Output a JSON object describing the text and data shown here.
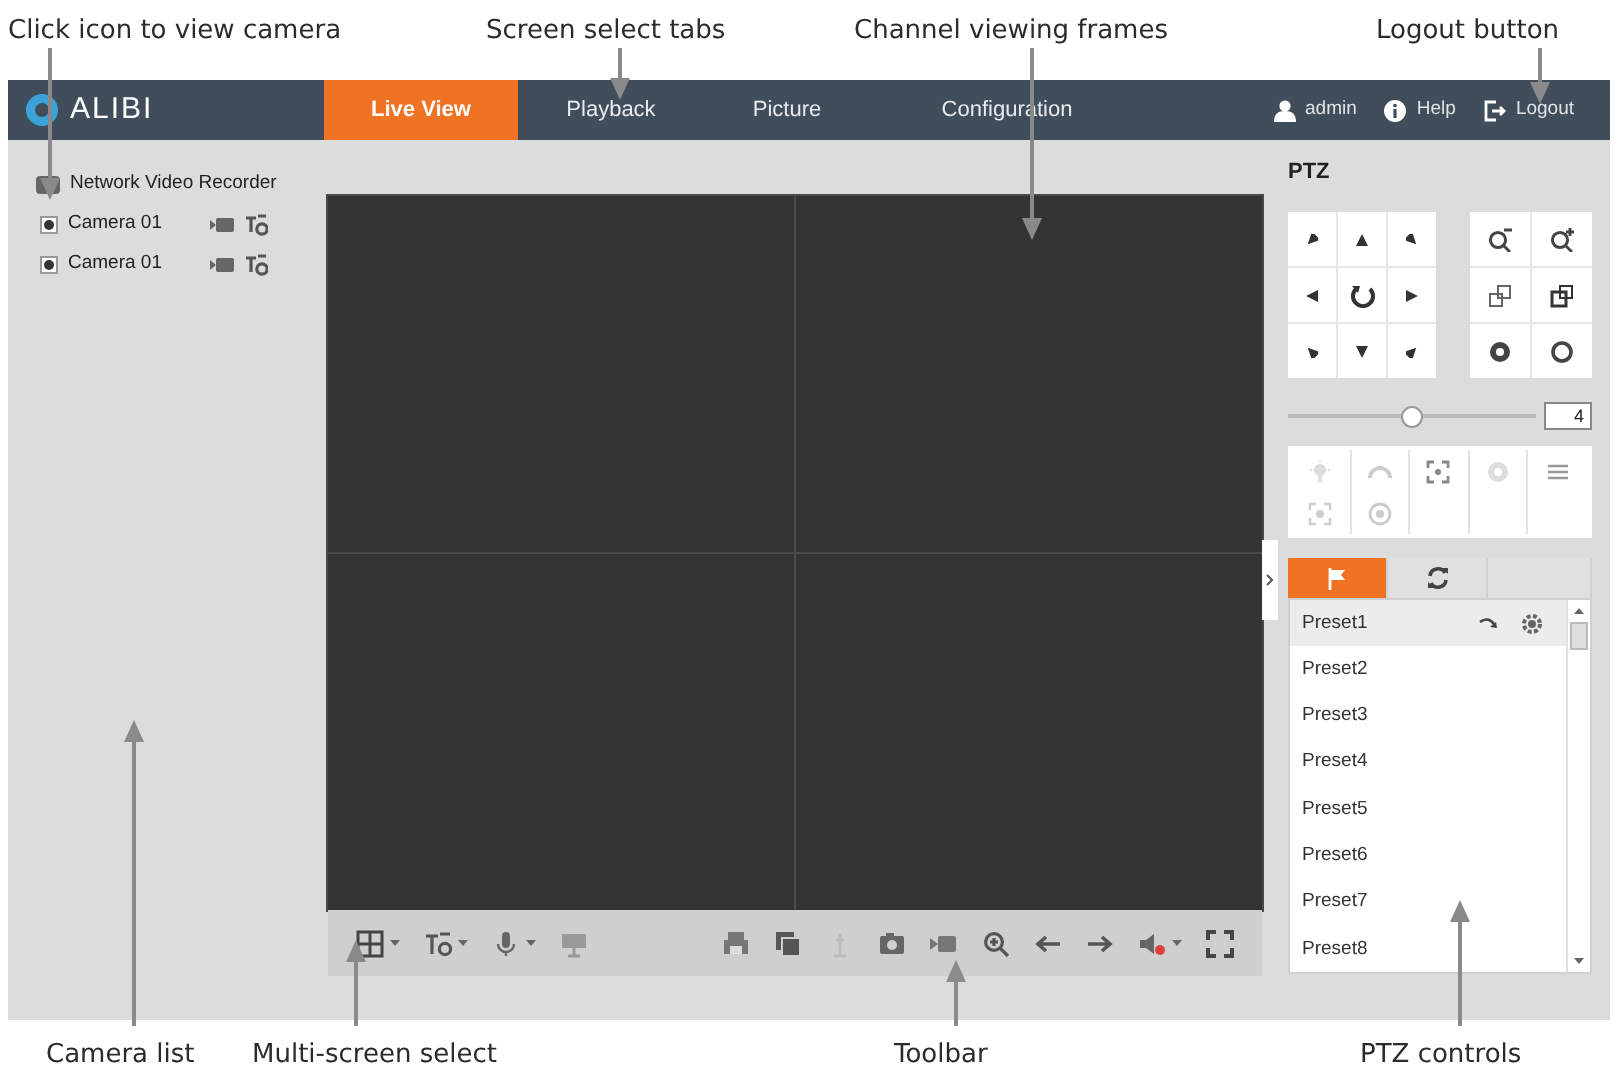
{
  "annotations_top": [
    "Click icon to view camera",
    "Screen select tabs",
    "Channel viewing frames",
    "Logout button"
  ],
  "header": {
    "logo": "ALIBI",
    "tabs": [
      {
        "label": "Live View",
        "selected": true
      },
      {
        "label": "Playback",
        "selected": false
      },
      {
        "label": "Picture",
        "selected": false
      },
      {
        "label": "Configuration",
        "selected": false
      }
    ],
    "user": "admin",
    "help": "Help",
    "logout": "Logout"
  },
  "camera_tree": {
    "root": "Network Video Recorder",
    "cameras": [
      {
        "label": "Camera 01"
      },
      {
        "label": "Camera 01"
      }
    ]
  },
  "ptz": {
    "title": "PTZ",
    "speed": {
      "level": 0.5,
      "reading": "4"
    },
    "tabs": [
      {
        "kind": "preset",
        "selected": true
      },
      {
        "kind": "patrol",
        "selected": false
      }
    ],
    "presets": [
      {
        "label": "Preset1",
        "selected": true
      },
      {
        "label": "Preset2",
        "selected": false
      },
      {
        "label": "Preset3",
        "selected": false
      },
      {
        "label": "Preset4",
        "selected": false
      },
      {
        "label": "Preset5",
        "selected": false
      },
      {
        "label": "Preset6",
        "selected": false
      },
      {
        "label": "Preset7",
        "selected": false
      },
      {
        "label": "Preset8",
        "selected": false
      }
    ]
  },
  "annotations_bottom": [
    "Camera list",
    "Multi-screen select",
    "Toolbar",
    "PTZ controls"
  ]
}
